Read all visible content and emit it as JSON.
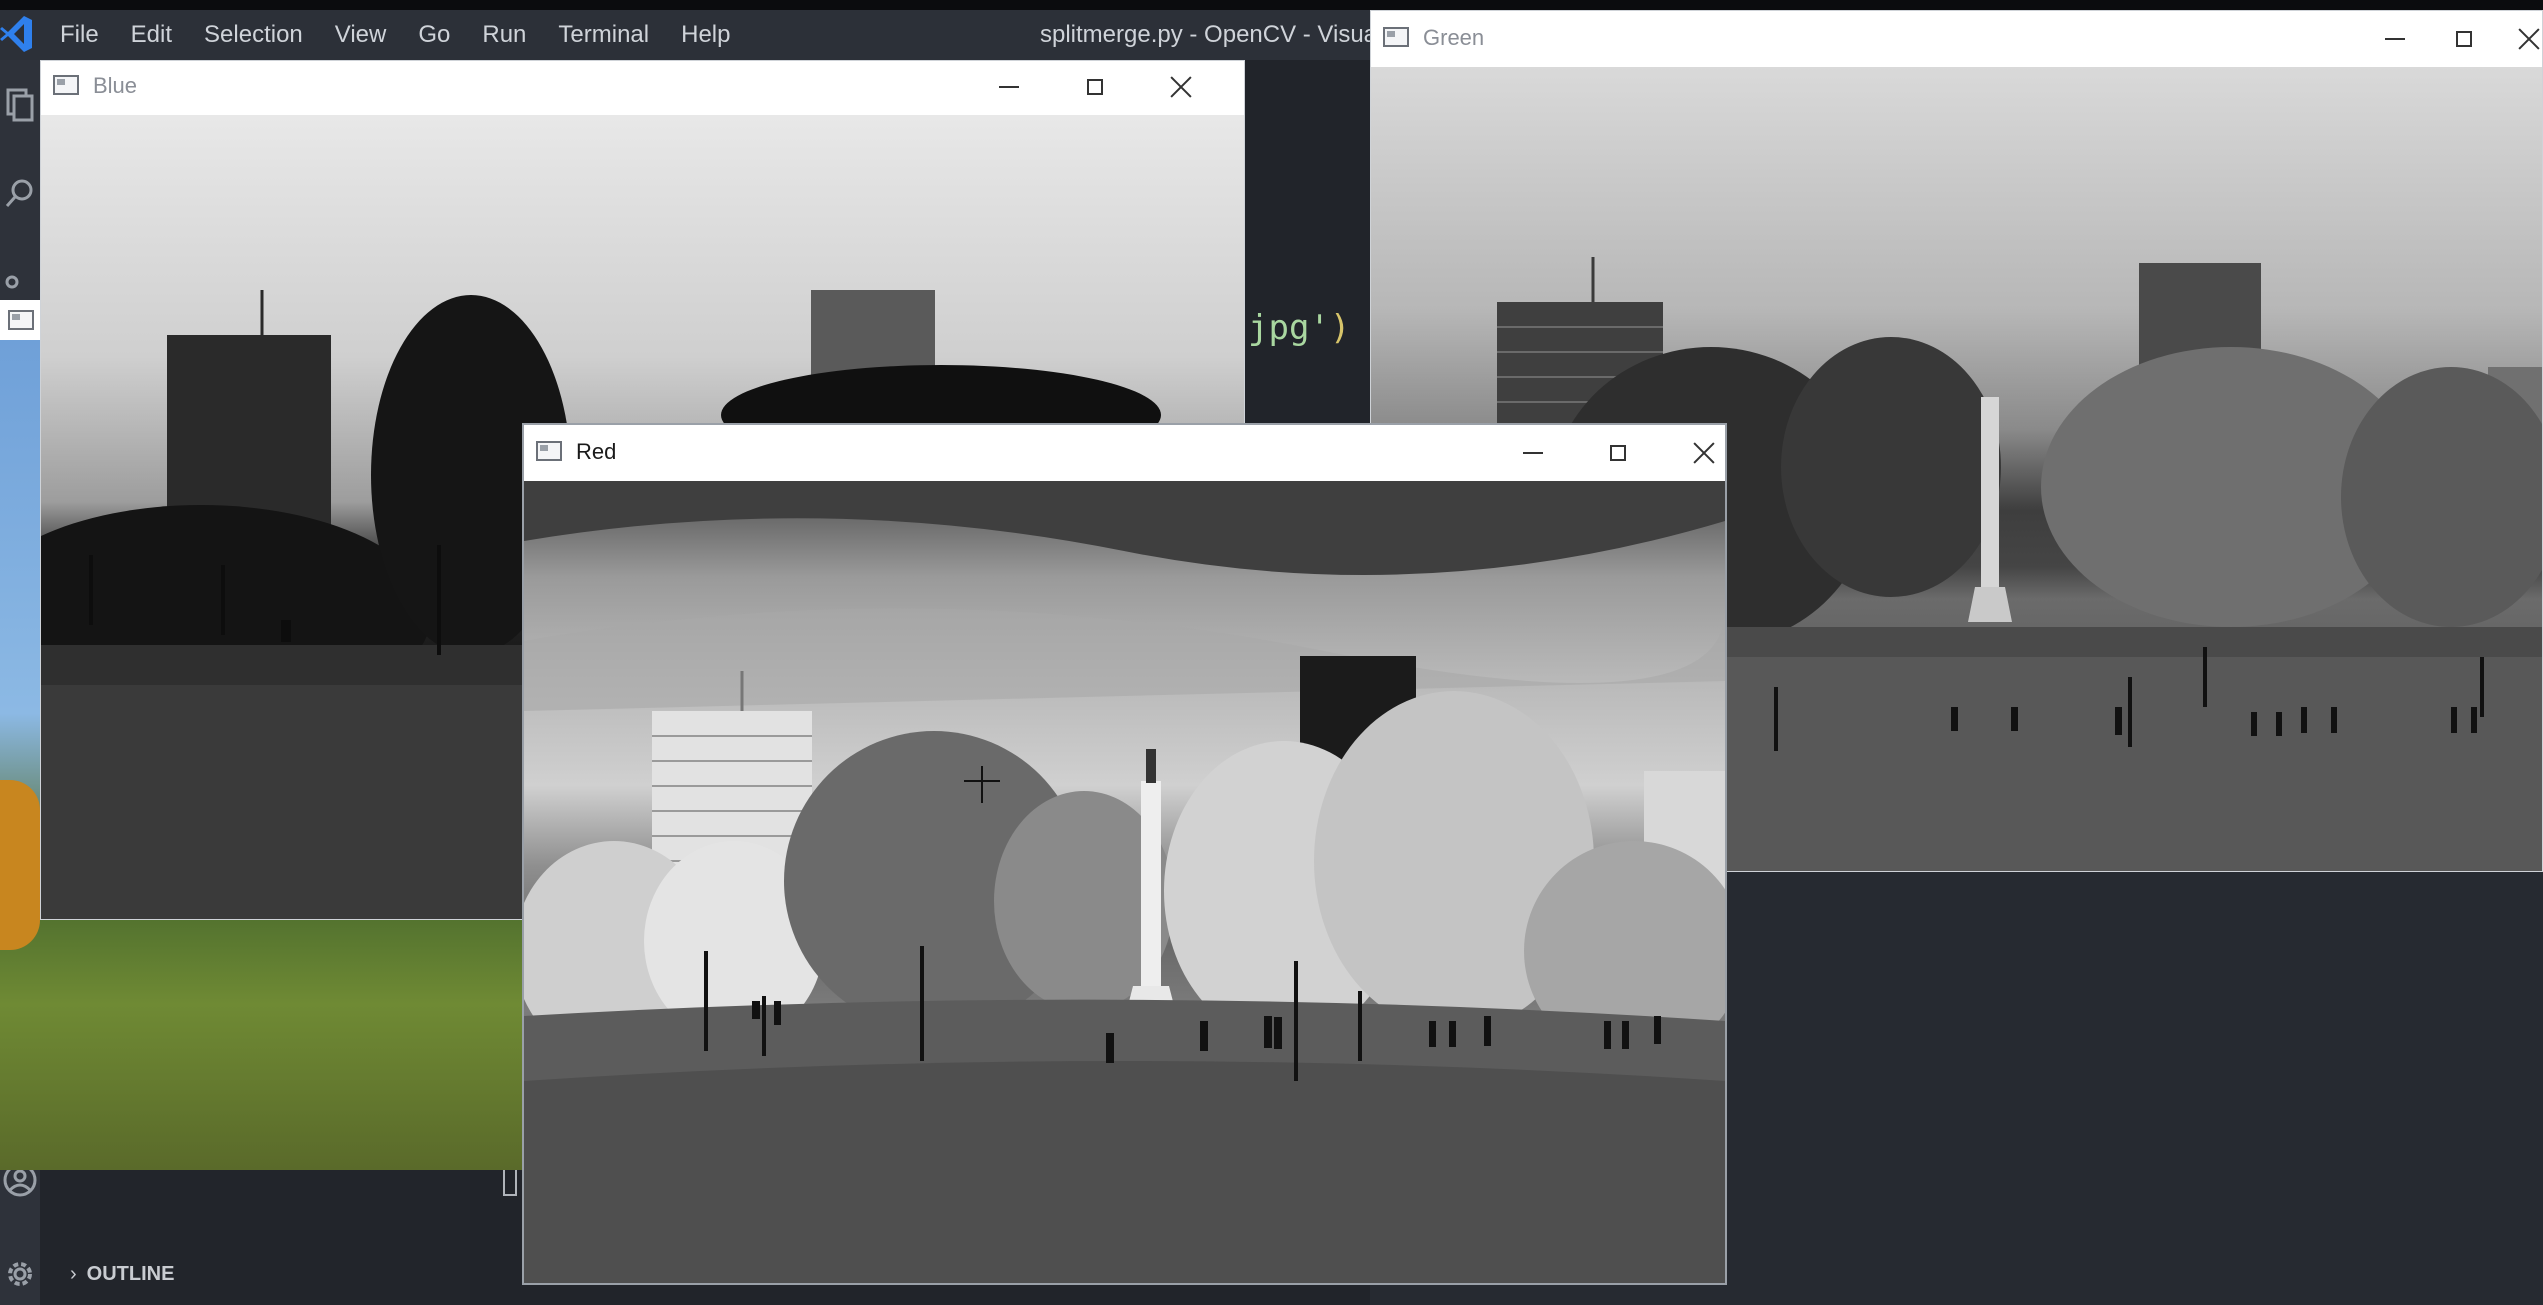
{
  "vscode": {
    "menu": [
      "File",
      "Edit",
      "Selection",
      "View",
      "Go",
      "Run",
      "Terminal",
      "Help"
    ],
    "window_title": "splitmerge.py - OpenCV - Visual",
    "code_fragment": "jpg'",
    "code_paren": ")",
    "outline_label": "OUTLINE",
    "accent_color": "#2f80ed"
  },
  "windows": {
    "blue": {
      "title": "Blue"
    },
    "green": {
      "title": "Green"
    },
    "red": {
      "title": "Red"
    }
  },
  "icons": {
    "minimize": "minimize-icon",
    "maximize": "maximize-icon",
    "close": "close-icon",
    "app": "window-app-icon"
  }
}
